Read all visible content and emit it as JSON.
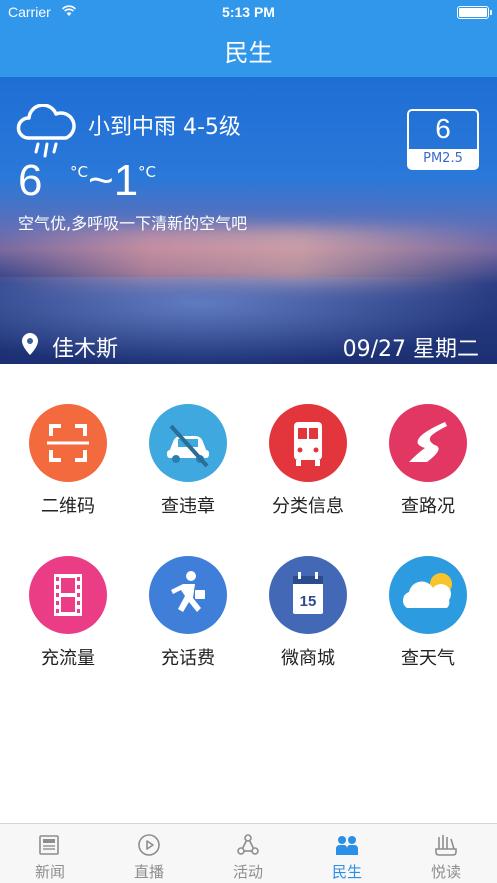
{
  "status_bar": {
    "carrier": "Carrier",
    "time": "5:13 PM",
    "battery_level": 1.0
  },
  "nav": {
    "title": "民生"
  },
  "weather": {
    "condition": "小到中雨 4-5级",
    "temp_low": "6",
    "temp_unit": "°C",
    "temp_sep": "~1",
    "tip": "空气优,多呼吸一下清新的空气吧",
    "pm_value": "6",
    "pm_label": "PM2.5",
    "city": "佳木斯",
    "date": "09/27 星期二"
  },
  "services": [
    {
      "label": "二维码",
      "icon": "qr-scan-icon",
      "color": "#f26a3d"
    },
    {
      "label": "查违章",
      "icon": "car-violation-icon",
      "color": "#3fa9df"
    },
    {
      "label": "分类信息",
      "icon": "bus-icon",
      "color": "#e2363c"
    },
    {
      "label": "查路况",
      "icon": "road-icon",
      "color": "#e33763"
    },
    {
      "label": "充流量",
      "icon": "film-icon",
      "color": "#ea3d86"
    },
    {
      "label": "充话费",
      "icon": "runner-icon",
      "color": "#3f7fd9"
    },
    {
      "label": "微商城",
      "icon": "calendar-icon",
      "color": "#4368b5"
    },
    {
      "label": "查天气",
      "icon": "weather-cloud-icon",
      "color": "#2c9be0"
    }
  ],
  "tabs": [
    {
      "label": "新闻",
      "icon": "newspaper-icon",
      "active": false
    },
    {
      "label": "直播",
      "icon": "play-icon",
      "active": false
    },
    {
      "label": "活动",
      "icon": "network-icon",
      "active": false
    },
    {
      "label": "民生",
      "icon": "people-icon",
      "active": true
    },
    {
      "label": "悦读",
      "icon": "books-icon",
      "active": false
    }
  ],
  "colors": {
    "primary": "#3197ea",
    "tab_active": "#2a8fe6",
    "tab_inactive": "#8e8e8e"
  }
}
